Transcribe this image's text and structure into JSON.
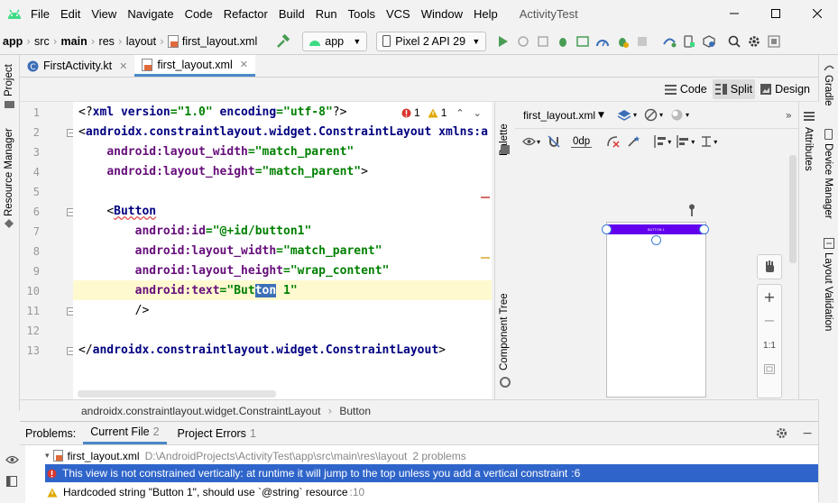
{
  "menu": [
    "File",
    "Edit",
    "View",
    "Navigate",
    "Code",
    "Refactor",
    "Build",
    "Run",
    "Tools",
    "VCS",
    "Window",
    "Help"
  ],
  "window_title": "ActivityTest",
  "breadcrumb": [
    "app",
    "src",
    "main",
    "res",
    "layout",
    "first_layout.xml"
  ],
  "run_config": "app",
  "device": "Pixel 2 API 29",
  "left_tools": [
    "Project",
    "Resource Manager"
  ],
  "right_tools": [
    "Gradle",
    "Device Manager",
    "Layout Validation"
  ],
  "tabs": [
    {
      "label": "FirstActivity.kt",
      "active": false
    },
    {
      "label": "first_layout.xml",
      "active": true
    }
  ],
  "modes": [
    {
      "label": "Code",
      "active": false
    },
    {
      "label": "Split",
      "active": true
    },
    {
      "label": "Design",
      "active": false
    }
  ],
  "inspections": {
    "errors": "1",
    "warnings": "1"
  },
  "code_lines": [
    {
      "n": "1",
      "html": "<span class=\"plain\">&lt;?</span><span class=\"tag\">xml version</span><span class=\"str\">=\"1.0\"</span> <span class=\"tag\">encoding</span><span class=\"str\">=\"utf-8\"</span><span class=\"plain\">?&gt;</span>"
    },
    {
      "n": "2",
      "html": "<span class=\"plain\">&lt;</span><span class=\"tag\">androidx.constraintlayout.widget.ConstraintLayout xmlns:a</span>"
    },
    {
      "n": "3",
      "html": "    <span class=\"attr\">android:layout_width</span><span class=\"str\">=\"match_parent\"</span>"
    },
    {
      "n": "4",
      "html": "    <span class=\"attr\">android:layout_height</span><span class=\"str\">=\"match_parent\"</span><span class=\"plain\">&gt;</span>"
    },
    {
      "n": "5",
      "html": ""
    },
    {
      "n": "6",
      "html": "    <span class=\"plain\">&lt;</span><span class=\"tag\" style=\"text-decoration:underline wavy #e05050;\">Button</span>"
    },
    {
      "n": "7",
      "html": "        <span class=\"attr\">android:id</span><span class=\"str\">=\"@+id/button1\"</span>"
    },
    {
      "n": "8",
      "html": "        <span class=\"attr\">android:layout_width</span><span class=\"str\">=\"match_parent\"</span>"
    },
    {
      "n": "9",
      "html": "        <span class=\"attr\">android:layout_height</span><span class=\"str\">=\"wrap_content\"</span>"
    },
    {
      "n": "10",
      "html": "        <span class=\"attr\">android:text</span><span class=\"str\">=\"But<span style=\"background:#3b6fb6;color:#fff;\">ton</span> 1\"</span>"
    },
    {
      "n": "11",
      "html": "        <span class=\"plain\">/&gt;</span>"
    },
    {
      "n": "12",
      "html": ""
    },
    {
      "n": "13",
      "html": "<span class=\"plain\">&lt;/</span><span class=\"tag\">androidx.constraintlayout.widget.ConstraintLayout</span><span class=\"plain\">&gt;</span>"
    }
  ],
  "side_labels": {
    "palette": "Palette",
    "component_tree": "Component Tree",
    "attributes": "Attributes"
  },
  "design": {
    "file_combo": "first_layout.xml",
    "margin": "0dp",
    "zoom_label": "1:1",
    "button_text": "BUTTON 1"
  },
  "path_bar": [
    "androidx.constraintlayout.widget.ConstraintLayout",
    "Button"
  ],
  "problems": {
    "title": "Problems:",
    "tabs": [
      {
        "label": "Current File",
        "count": "2",
        "active": true
      },
      {
        "label": "Project Errors",
        "count": "1",
        "active": false
      }
    ],
    "file": "first_layout.xml",
    "file_path": "D:\\AndroidProjects\\ActivityTest\\app\\src\\main\\res\\layout",
    "file_count": "2 problems",
    "items": [
      {
        "severity": "error",
        "text": "This view is not constrained vertically: at runtime it will jump to the top unless you add a vertical constraint",
        "loc": ":6"
      },
      {
        "severity": "warning",
        "text": "Hardcoded string \"Button 1\", should use `@string` resource",
        "loc": ":10"
      }
    ]
  },
  "colors": {
    "accent": "#4a88c7",
    "selection": "#2f65ca",
    "button_purple": "#6200ee",
    "error": "#d9362f",
    "warning": "#e0a800"
  }
}
